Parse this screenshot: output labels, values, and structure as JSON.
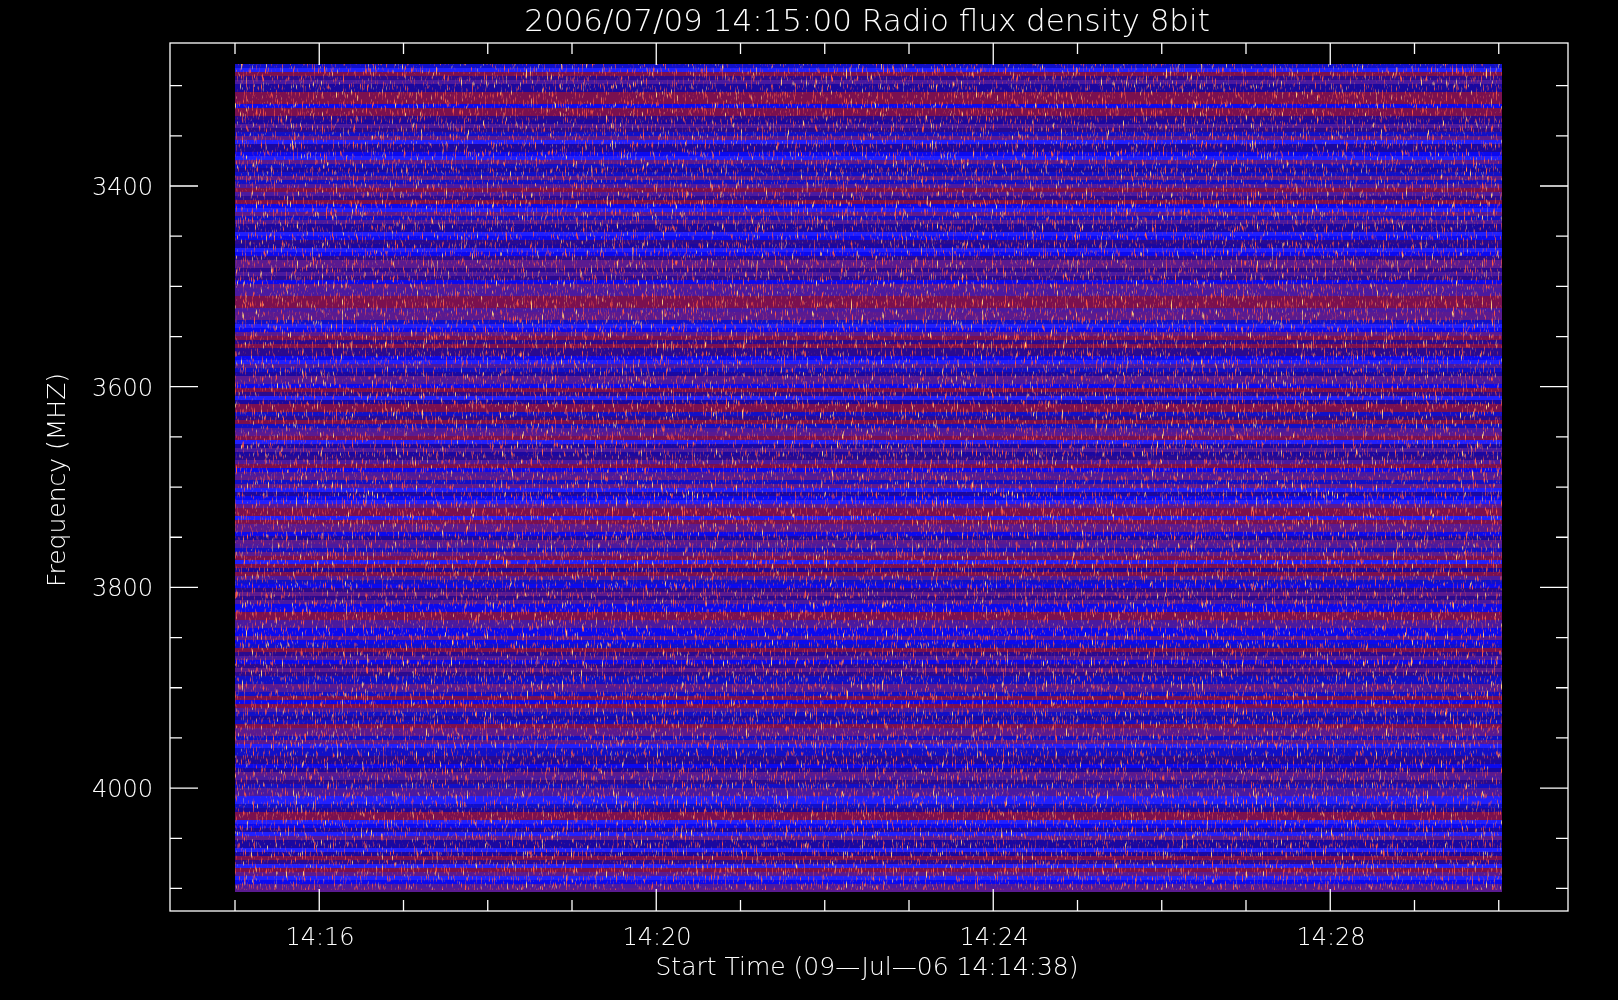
{
  "title": "2006/07/09 14:15:00 Radio flux density 8bit",
  "plot": {
    "y_label": "Frequency (MHZ)",
    "x_label": "Start Time (09—Jul—06 14:14:38)",
    "y_ticks": [
      "3400",
      "3600",
      "3800",
      "4000"
    ],
    "x_ticks": [
      "14:16",
      "14:20",
      "14:24",
      "14:28"
    ]
  }
}
